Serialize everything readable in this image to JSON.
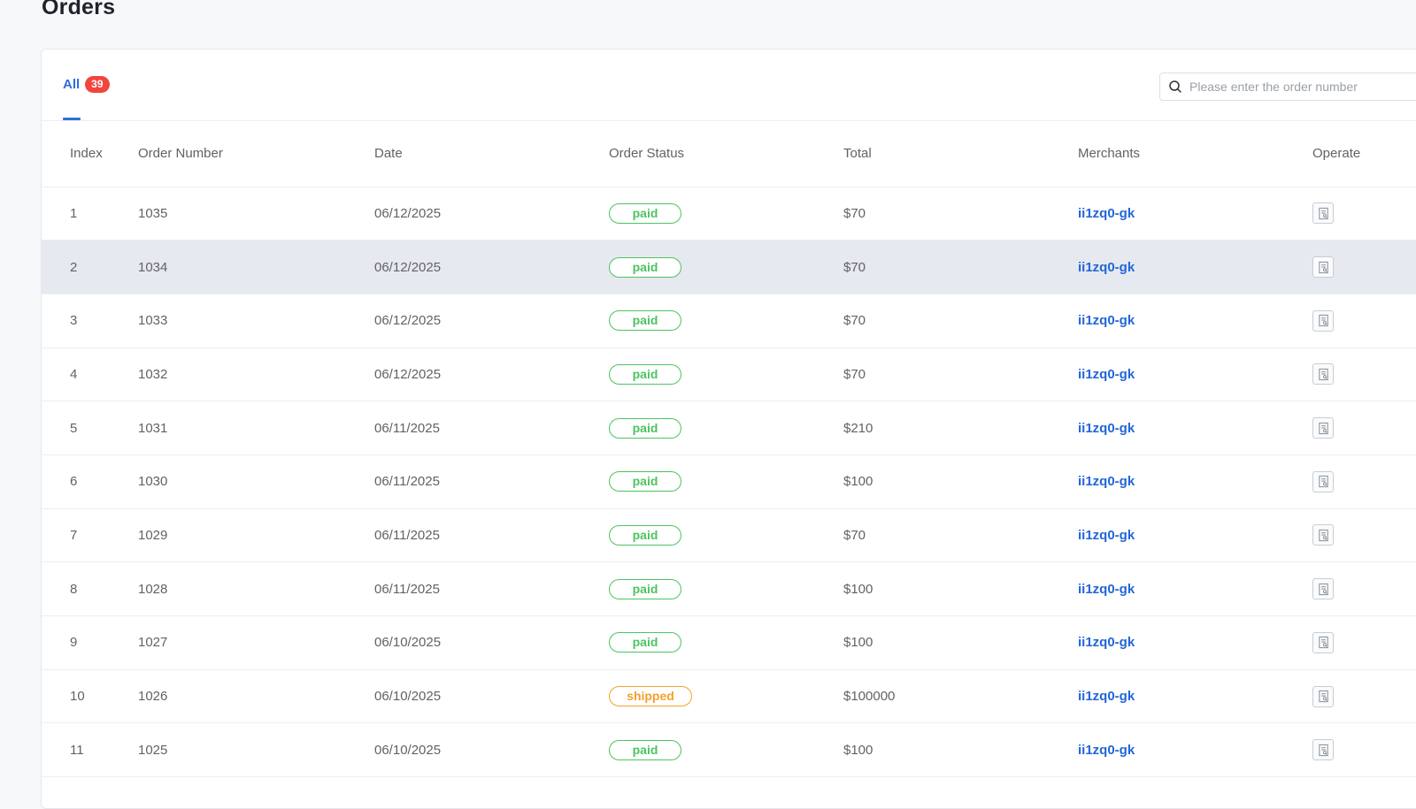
{
  "page": {
    "title": "Orders"
  },
  "tabs": [
    {
      "label": "All",
      "count": "39"
    }
  ],
  "search": {
    "placeholder": "Please enter the order number",
    "value": ""
  },
  "table": {
    "columns": [
      "Index",
      "Order Number",
      "Date",
      "Order Status",
      "Total",
      "Merchants",
      "Operate"
    ],
    "rows": [
      {
        "index": "1",
        "order_number": "1035",
        "date": "06/12/2025",
        "status": "paid",
        "total": "$70",
        "merchant": "ii1zq0-gk"
      },
      {
        "index": "2",
        "order_number": "1034",
        "date": "06/12/2025",
        "status": "paid",
        "total": "$70",
        "merchant": "ii1zq0-gk"
      },
      {
        "index": "3",
        "order_number": "1033",
        "date": "06/12/2025",
        "status": "paid",
        "total": "$70",
        "merchant": "ii1zq0-gk"
      },
      {
        "index": "4",
        "order_number": "1032",
        "date": "06/12/2025",
        "status": "paid",
        "total": "$70",
        "merchant": "ii1zq0-gk"
      },
      {
        "index": "5",
        "order_number": "1031",
        "date": "06/11/2025",
        "status": "paid",
        "total": "$210",
        "merchant": "ii1zq0-gk"
      },
      {
        "index": "6",
        "order_number": "1030",
        "date": "06/11/2025",
        "status": "paid",
        "total": "$100",
        "merchant": "ii1zq0-gk"
      },
      {
        "index": "7",
        "order_number": "1029",
        "date": "06/11/2025",
        "status": "paid",
        "total": "$70",
        "merchant": "ii1zq0-gk"
      },
      {
        "index": "8",
        "order_number": "1028",
        "date": "06/11/2025",
        "status": "paid",
        "total": "$100",
        "merchant": "ii1zq0-gk"
      },
      {
        "index": "9",
        "order_number": "1027",
        "date": "06/10/2025",
        "status": "paid",
        "total": "$100",
        "merchant": "ii1zq0-gk"
      },
      {
        "index": "10",
        "order_number": "1026",
        "date": "06/10/2025",
        "status": "shipped",
        "total": "$100000",
        "merchant": "ii1zq0-gk"
      },
      {
        "index": "11",
        "order_number": "1025",
        "date": "06/10/2025",
        "status": "paid",
        "total": "$100",
        "merchant": "ii1zq0-gk"
      }
    ]
  },
  "colors": {
    "accent": "#2f6fd6",
    "badge": "#f2453d",
    "paid": "#4cc361",
    "shipped": "#f3a12b",
    "link": "#2266d8",
    "row_hover": "#e6e9ef"
  },
  "icons": {
    "search": "search-icon",
    "operate": "receipt-icon"
  }
}
